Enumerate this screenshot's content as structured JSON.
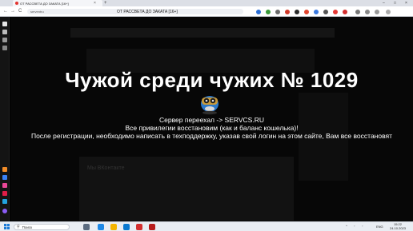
{
  "browser": {
    "tab_title": "ОТ РАССВЕТА ДО ЗАКАТА [16+]",
    "tab_close": "×",
    "new_tab": "+",
    "url": "serventru",
    "page_title": "ОТ РАССВЕТА ДО ЗАКАТА [16+]",
    "back": "←",
    "forward": "→",
    "reload": "C",
    "minimize": "–",
    "maximize": "□",
    "close": "×"
  },
  "main": {
    "heading": "Чужой среди чужих  № 1029",
    "line1": "Сервер переехал -> SERVCS.RU",
    "line2": "Все привилегии восстановим (как и баланс кошелька)!",
    "line3": "После регистрации, необходимо написать в техподдержку, указав свой логин на этом сайте, Вам все восстановят",
    "background_block_title": "Мы ВКонтакте"
  },
  "taskbar": {
    "search_placeholder": "Поиск",
    "language": "ENG",
    "time": "15:22",
    "date": "24.10.2023"
  },
  "colors": {
    "page_bg": "#070707",
    "text": "#ffffff",
    "taskbar_bg": "#e9edf3"
  }
}
